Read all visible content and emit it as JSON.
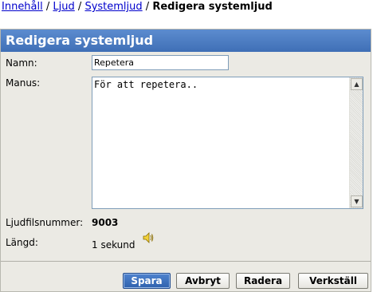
{
  "breadcrumb": {
    "items": [
      "Innehåll",
      "Ljud",
      "Systemljud"
    ],
    "separator": "/",
    "current": "Redigera systemljud"
  },
  "panel": {
    "title": "Redigera systemljud"
  },
  "form": {
    "name_label": "Namn:",
    "name_value": "Repetera",
    "script_label": "Manus:",
    "script_value": "För att repetera..",
    "file_number_label": "Ljudfilsnummer:",
    "file_number_value": "9003",
    "length_label": "Längd:",
    "length_value": "1 sekund"
  },
  "icons": {
    "speaker": "speaker-icon",
    "scroll_up": "scroll-up-arrow-icon",
    "scroll_down": "scroll-down-arrow-icon"
  },
  "buttons": {
    "save": "Spara",
    "cancel": "Avbryt",
    "delete": "Radera",
    "apply": "Verkställ"
  },
  "colors": {
    "header": "#4a7cc4",
    "link": "#0000cc",
    "panel_bg": "#ebeae4"
  }
}
